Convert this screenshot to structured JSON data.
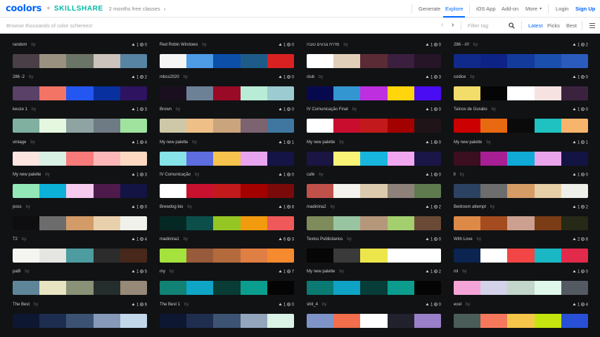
{
  "nav": {
    "logo": "coolors",
    "plus": "+",
    "skillshare": "SKILLSHARE",
    "promo": "2 months free classes",
    "promo_arrow": "›",
    "items": [
      "Generate",
      "Explore",
      "iOS App",
      "Add-on",
      "More",
      "Login",
      "Sign Up"
    ],
    "more_caret": "▾",
    "active": "Explore",
    "accent": "#0066ff"
  },
  "searchbar": {
    "placeholder": "Browse thousands of color schemes!",
    "prev": "‹",
    "next": "›",
    "filter_placeholder": "Filter tag",
    "sort": [
      "Latest",
      "Picks",
      "Best"
    ],
    "active_sort": "Latest"
  },
  "palettes": [
    {
      "name": "random",
      "by": "by",
      "likes": "1",
      "views": "0",
      "colors": [
        "#4a3f47",
        "#9b9181",
        "#6b7567",
        "#cbc3bc",
        "#5784a3"
      ]
    },
    {
      "name": "Red Robin Windows",
      "by": "by",
      "likes": "1",
      "views": "0",
      "colors": [
        "#f5f5f5",
        "#4e9be6",
        "#0c4fa9",
        "#1e5b89",
        "#d92121"
      ]
    },
    {
      "name": "סדרת צבעים טובה",
      "by": "by",
      "likes": "1",
      "views": "0",
      "colors": [
        "#ffffff",
        "#e2cfba",
        "#5a2b35",
        "#3b1f3f",
        "#251526"
      ]
    },
    {
      "name": "286 - ////",
      "by": "by",
      "likes": "1",
      "views": "2",
      "colors": [
        "#0f2a8a",
        "#0d2486",
        "#133b9c",
        "#1a4fad",
        "#2a5bbd"
      ]
    },
    {
      "name": "286 -2",
      "by": "by",
      "likes": "1",
      "views": "2",
      "colors": [
        "#5a4167",
        "#f37464",
        "#2457f2",
        "#08309e",
        "#2e1360"
      ]
    },
    {
      "name": "mbcs2020",
      "by": "by",
      "likes": "1",
      "views": "0",
      "colors": [
        "#1a0f1f",
        "#6c8196",
        "#980a25",
        "#b9ecd6",
        "#9ccbd1"
      ]
    },
    {
      "name": "club",
      "by": "by",
      "likes": "1",
      "views": "3",
      "colors": [
        "#07094f",
        "#3496d1",
        "#be2fe0",
        "#ffd50b",
        "#4a0cf2"
      ]
    },
    {
      "name": "codice",
      "by": "by",
      "likes": "1",
      "views": "0",
      "colors": [
        "#f2dc6a",
        "#050505",
        "#ffffff",
        "#f6e3e1",
        "#3b2340"
      ]
    },
    {
      "name": "keuze 1",
      "by": "by",
      "likes": "1",
      "views": "3",
      "colors": [
        "#7fb0a0",
        "#e6f7e0",
        "#8fa3a3",
        "#6e7a84",
        "#9fe39e"
      ]
    },
    {
      "name": "Brown",
      "by": "by",
      "likes": "1",
      "views": "0",
      "colors": [
        "#cfc8a8",
        "#eec088",
        "#caa47d",
        "#7c6370",
        "#3f77a0"
      ]
    },
    {
      "name": "IV Comunicação Final",
      "by": "by",
      "likes": "1",
      "views": "0",
      "colors": [
        "#ffffff",
        "#c80d2f",
        "#c21a1c",
        "#a30000",
        "#1f1417"
      ]
    },
    {
      "name": "Taínos de Gurabo",
      "by": "by",
      "likes": "1",
      "views": "0",
      "colors": [
        "#cc0000",
        "#e86a10",
        "#0a0a0a",
        "#1fc1c1",
        "#f7b46b"
      ]
    },
    {
      "name": "vintage",
      "by": "by",
      "likes": "1",
      "views": "4",
      "colors": [
        "#fde5e1",
        "#d9f0e5",
        "#f87b7b",
        "#fcb8b8",
        "#fdd9c2"
      ]
    },
    {
      "name": "My new palette",
      "by": "by",
      "likes": "1",
      "views": "1",
      "colors": [
        "#86e3e8",
        "#5e6de0",
        "#f8c24e",
        "#e8a4ef",
        "#141446"
      ]
    },
    {
      "name": "My new palette",
      "by": "by",
      "likes": "1",
      "views": "0",
      "colors": [
        "#1a1543",
        "#f9f476",
        "#18b6df",
        "#f0a7ef",
        "#1a1648"
      ]
    },
    {
      "name": "My new palette",
      "by": "by",
      "likes": "1",
      "views": "1",
      "colors": [
        "#3b0e20",
        "#a81e95",
        "#10aad6",
        "#eaa4ec",
        "#131444"
      ]
    },
    {
      "name": "My new palette",
      "by": "by",
      "likes": "1",
      "views": "3",
      "colors": [
        "#93e8b8",
        "#0cb1d8",
        "#f6cbef",
        "#4e1a4b",
        "#131444"
      ]
    },
    {
      "name": "IV Comunicação",
      "by": "by",
      "likes": "1",
      "views": "0",
      "colors": [
        "#ffffff",
        "#c8112f",
        "#c21a1c",
        "#a30000",
        "#7a0a0a"
      ]
    },
    {
      "name": "cafe",
      "by": "by",
      "likes": "1",
      "views": "0",
      "colors": [
        "#c0514a",
        "#f4f2ed",
        "#dccaaf",
        "#8d8179",
        "#5f7a4f"
      ]
    },
    {
      "name": "ll",
      "by": "by",
      "likes": "1",
      "views": "0",
      "colors": [
        "#2c4262",
        "#6d6d6d",
        "#d69c65",
        "#e7cfa8",
        "#efefea"
      ]
    },
    {
      "name": "poss",
      "by": "by",
      "likes": "1",
      "views": "0",
      "colors": [
        "#0e0e10",
        "#6c6c6c",
        "#d39b67",
        "#e9d0ad",
        "#f1f1ec"
      ]
    },
    {
      "name": "Brewdog bio",
      "by": "by",
      "likes": "1",
      "views": "8",
      "colors": [
        "#062825",
        "#0c4f4a",
        "#96c623",
        "#f29b0e",
        "#ef5959"
      ]
    },
    {
      "name": "madinina2",
      "by": "by",
      "likes": "1",
      "views": "2",
      "colors": [
        "#7e8b5a",
        "#99c4a2",
        "#b5977b",
        "#a3cf6e",
        "#6a4a37"
      ]
    },
    {
      "name": "Bedroom attempt",
      "by": "by",
      "likes": "1",
      "views": "2",
      "colors": [
        "#dd8a48",
        "#a44c20",
        "#cba090",
        "#7a3c14",
        "#252916"
      ]
    },
    {
      "name": "T2",
      "by": "by",
      "likes": "1",
      "views": "4",
      "colors": [
        "#f4f4f1",
        "#e5e6e2",
        "#4d9ca0",
        "#2c2c2c",
        "#47281b"
      ]
    },
    {
      "name": "madinina1",
      "by": "by",
      "likes": "6",
      "views": "3",
      "colors": [
        "#a5e23e",
        "#975a3a",
        "#b36a3c",
        "#e07f44",
        "#f68a2e"
      ]
    },
    {
      "name": "Textos Publicitarios",
      "by": "by",
      "likes": "1",
      "views": "0",
      "colors": [
        "#060606",
        "#3a3a3a",
        "#ede64a",
        "#ffffff",
        "#ffffff"
      ]
    },
    {
      "name": "With Love",
      "by": "by",
      "likes": "2",
      "views": "8",
      "colors": [
        "#0b2450",
        "#ffffff",
        "#f24545",
        "#1ab7c5",
        "#e22a4a"
      ]
    },
    {
      "name": "pal9",
      "by": "by",
      "likes": "1",
      "views": "5",
      "colors": [
        "#5f8599",
        "#e8e4c2",
        "#899177",
        "#262d2d",
        "#978978"
      ]
    },
    {
      "name": "my",
      "by": "by",
      "likes": "1",
      "views": "7",
      "colors": [
        "#118274",
        "#0fa5c7",
        "#083c35",
        "#0b9e8f",
        "#040404"
      ]
    },
    {
      "name": "My new palette",
      "by": "by",
      "likes": "1",
      "views": "2",
      "colors": [
        "#0b7a72",
        "#0ea3c4",
        "#063d38",
        "#0b9c8e",
        "#040404"
      ]
    },
    {
      "name": "ml",
      "by": "by",
      "likes": "1",
      "views": "0",
      "colors": [
        "#f5a4d8",
        "#d4d2e8",
        "#c2d6cb",
        "#e0f8ec",
        "#545a61"
      ]
    },
    {
      "name": "The Best",
      "by": "by",
      "likes": "1",
      "views": "6",
      "colors": [
        "#0e1731",
        "#1d2d50",
        "#3c5273",
        "#8799b8",
        "#c3d7ea"
      ]
    },
    {
      "name": "The Best 1",
      "by": "by",
      "likes": "1",
      "views": "0",
      "colors": [
        "#0e1731",
        "#1f2d4f",
        "#3d5374",
        "#93a5bc",
        "#dbf2e6"
      ]
    },
    {
      "name": "shit_4",
      "by": "by",
      "likes": "1",
      "views": "0",
      "colors": [
        "#7e94c8",
        "#f36e4d",
        "#ffffff",
        "#22222e",
        "#9a80c8"
      ]
    },
    {
      "name": "ecel",
      "by": "by",
      "likes": "1",
      "views": "4",
      "colors": [
        "#4a5d58",
        "#f6785c",
        "#f6c64a",
        "#c5e40f",
        "#2850d6"
      ]
    }
  ]
}
